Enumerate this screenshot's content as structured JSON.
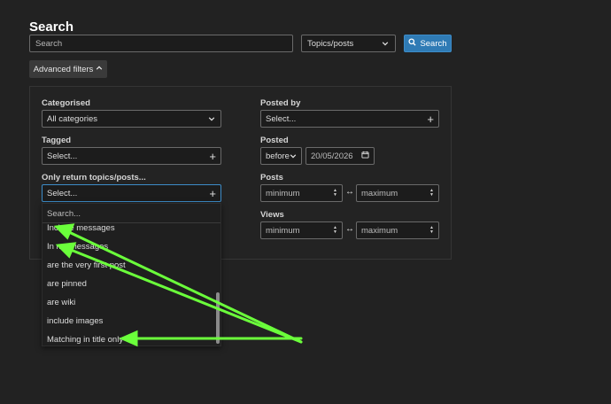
{
  "page": {
    "title": "Search"
  },
  "search": {
    "placeholder": "Search",
    "type_value": "Topics/posts",
    "button_label": "Search"
  },
  "advanced": {
    "toggle_label": "Advanced filters"
  },
  "filters": {
    "categorised": {
      "label": "Categorised",
      "value": "All categories"
    },
    "tagged": {
      "label": "Tagged",
      "value": "Select..."
    },
    "only_return": {
      "label": "Only return topics/posts...",
      "value": "Select..."
    },
    "posted_by": {
      "label": "Posted by",
      "value": "Select..."
    },
    "posted": {
      "label": "Posted",
      "qualifier": "before",
      "date": "20/05/2026"
    },
    "posts": {
      "label": "Posts",
      "min_placeholder": "minimum",
      "max_placeholder": "maximum"
    },
    "views": {
      "label": "Views",
      "min_placeholder": "minimum",
      "max_placeholder": "maximum"
    }
  },
  "dropdown": {
    "filter_placeholder": "Search...",
    "options": [
      "Include messages",
      "In my messages",
      "are the very first post",
      "are pinned",
      "are wiki",
      "include images",
      "Matching in title only"
    ]
  },
  "colors": {
    "background": "#222222",
    "accent": "#2f7bb5",
    "annotation_arrow": "#6bff3b"
  }
}
